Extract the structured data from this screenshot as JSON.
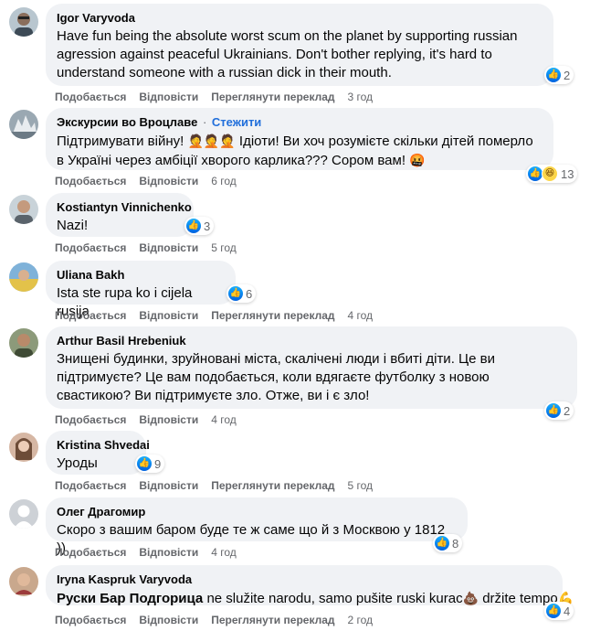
{
  "comments": [
    {
      "author": "Igor Varyvoda",
      "text": "Have fun being the absolute worst scum on the planet by supporting russian agression against peaceful Ukrainians. Don't bother replying, it's hard to understand someone with a russian dick in their mouth.",
      "reaction_count": "2",
      "reactions": [
        "like"
      ],
      "actions": {
        "like": "Подобається",
        "reply": "Відповісти",
        "translate": "Переглянути переклад"
      },
      "time": "3 год"
    },
    {
      "author": "Экскурсии во Вроцлаве",
      "follow": "Стежити",
      "text_part1": "Підтримувати війну! ",
      "emoji_facepalm": "🤦🤦🤦",
      "text_part2": " Ідіоти! Ви хоч розумієте скільки дітей померло в Україні через амбіції хворого карлика??? Сором вам! ",
      "emoji_angry": "🤬",
      "reaction_count": "13",
      "reactions": [
        "like",
        "haha"
      ],
      "actions": {
        "like": "Подобається",
        "reply": "Відповісти"
      },
      "time": "6 год"
    },
    {
      "author": "Kostiantyn Vinnichenko",
      "text": "Nazi!",
      "reaction_count": "3",
      "reactions": [
        "like"
      ],
      "actions": {
        "like": "Подобається",
        "reply": "Відповісти"
      },
      "time": "5 год"
    },
    {
      "author": "Uliana Bakh",
      "text": "Ista ste rupa ko i cijela rusija",
      "reaction_count": "6",
      "reactions": [
        "like"
      ],
      "actions": {
        "like": "Подобається",
        "reply": "Відповісти",
        "translate": "Переглянути переклад"
      },
      "time": "4 год"
    },
    {
      "author": "Arthur Basil Hrebeniuk",
      "text": "Знищені будинки, зруйновані міста, скалічені люди і вбиті діти. Це ви підтримуєте? Це вам подобається, коли вдягаєте футболку з новою свастикою? Ви підтримуєте зло. Отже, ви і є зло!",
      "reaction_count": "2",
      "reactions": [
        "like"
      ],
      "actions": {
        "like": "Подобається",
        "reply": "Відповісти"
      },
      "time": "4 год"
    },
    {
      "author": "Kristina Shvedai",
      "text": "Уроды",
      "reaction_count": "9",
      "reactions": [
        "like"
      ],
      "actions": {
        "like": "Подобається",
        "reply": "Відповісти",
        "translate": "Переглянути переклад"
      },
      "time": "5 год"
    },
    {
      "author": "Олег Драгомир",
      "text": "Скоро з вашим баром буде те ж саме що й з Москвою у 1812 ))",
      "reaction_count": "8",
      "reactions": [
        "like"
      ],
      "actions": {
        "like": "Подобається",
        "reply": "Відповісти"
      },
      "time": "4 год"
    },
    {
      "author": "Iryna Kaspruk Varyvoda",
      "text_bold": "Руски Бар Подгорица",
      "text_rest": " ne služite narodu, samo pušite ruski kurac",
      "emoji_poop": "💩",
      "text_rest2": " držite tempo",
      "emoji_muscle": "💪",
      "reaction_count": "4",
      "reactions": [
        "like"
      ],
      "actions": {
        "like": "Подобається",
        "reply": "Відповісти",
        "translate": "Переглянути переклад"
      },
      "time": "2 год"
    }
  ]
}
